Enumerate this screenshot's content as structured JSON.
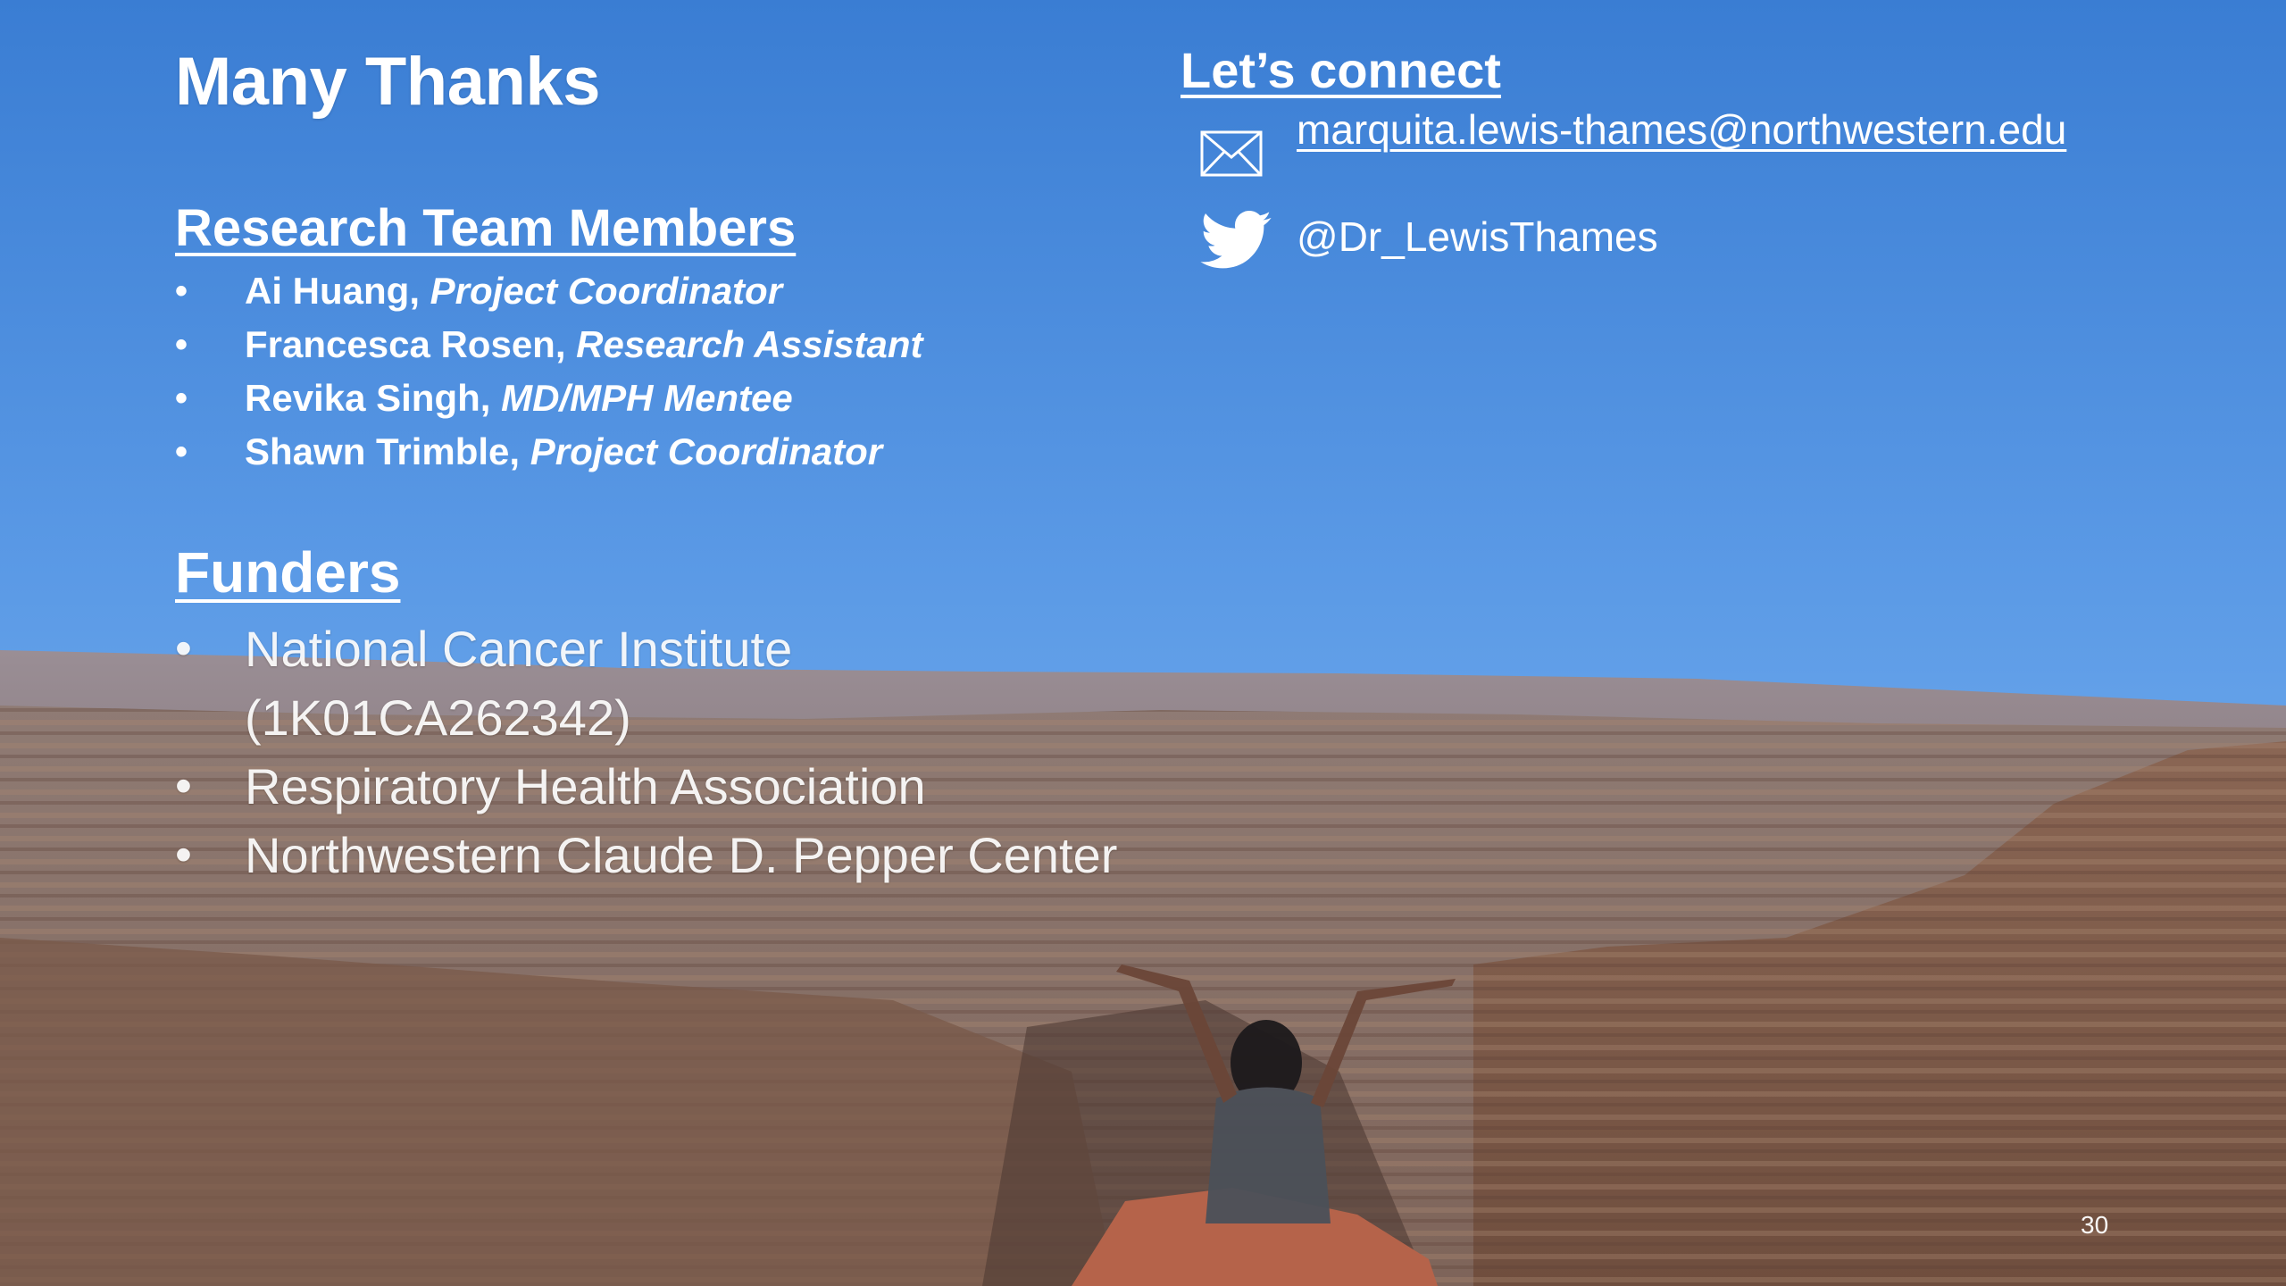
{
  "slide": {
    "title": "Many Thanks",
    "page_number": "30"
  },
  "team": {
    "heading": "Research Team Members",
    "members": [
      {
        "name": "Ai Huang, ",
        "role": "Project Coordinator"
      },
      {
        "name": "Francesca Rosen, ",
        "role": "Research Assistant"
      },
      {
        "name": "Revika Singh, ",
        "role": "MD/MPH Mentee"
      },
      {
        "name": "Shawn Trimble, ",
        "role": "Project Coordinator"
      }
    ]
  },
  "funders": {
    "heading": "Funders",
    "items": [
      {
        "line1": "National Cancer Institute",
        "line2": "(1K01CA262342)"
      },
      {
        "line1": "Respiratory Health Association"
      },
      {
        "line1": "Northwestern Claude D. Pepper Center"
      }
    ]
  },
  "connect": {
    "heading": "Let’s connect",
    "email": "marquita.lewis-thames@northwestern.edu",
    "email_icon": "envelope-icon",
    "twitter_handle": "@Dr_LewisThames",
    "twitter_icon": "twitter-bird-icon"
  },
  "colors": {
    "sky_top": "#3a7fd5",
    "sky_bottom": "#7ab4ef",
    "canyon": "#8a6a55",
    "text": "#ffffff"
  }
}
